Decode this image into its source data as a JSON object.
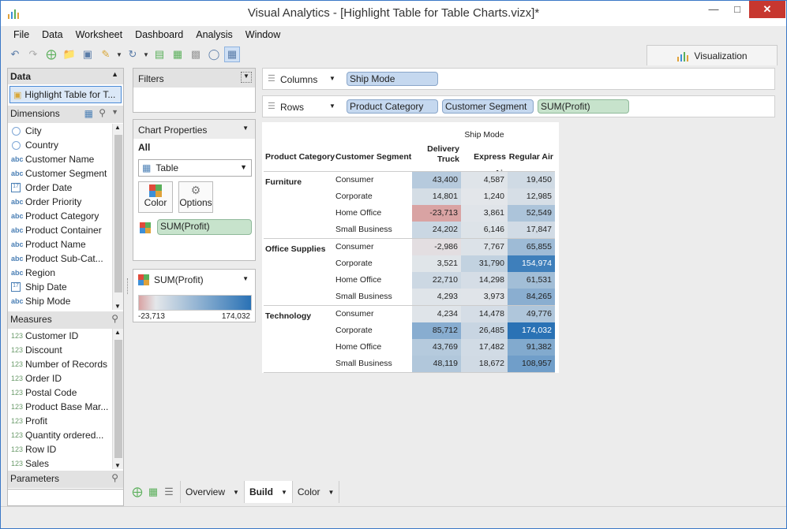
{
  "window": {
    "title": "Visual Analytics - [Highlight Table for Table Charts.vizx]*"
  },
  "menu": [
    "File",
    "Data",
    "Worksheet",
    "Dashboard",
    "Analysis",
    "Window"
  ],
  "viz_tab": "Visualization",
  "data_pane": {
    "header": "Data",
    "datasource": "Highlight Table for T...",
    "dimensions_label": "Dimensions",
    "dimensions": [
      {
        "label": "City",
        "type": "geo"
      },
      {
        "label": "Country",
        "type": "geo"
      },
      {
        "label": "Customer Name",
        "type": "abc"
      },
      {
        "label": "Customer Segment",
        "type": "abc"
      },
      {
        "label": "Order Date",
        "type": "date"
      },
      {
        "label": "Order Priority",
        "type": "abc"
      },
      {
        "label": "Product Category",
        "type": "abc"
      },
      {
        "label": "Product Container",
        "type": "abc"
      },
      {
        "label": "Product Name",
        "type": "abc"
      },
      {
        "label": "Product Sub-Cat...",
        "type": "abc"
      },
      {
        "label": "Region",
        "type": "abc"
      },
      {
        "label": "Ship Date",
        "type": "date"
      },
      {
        "label": "Ship Mode",
        "type": "abc"
      }
    ],
    "measures_label": "Measures",
    "measures": [
      "Customer ID",
      "Discount",
      "Number of Records",
      "Order ID",
      "Postal Code",
      "Product Base Mar...",
      "Profit",
      "Quantity ordered...",
      "Row ID",
      "Sales"
    ],
    "parameters_label": "Parameters",
    "type_labels": {
      "abc": "abc",
      "num": "123",
      "date": "17"
    }
  },
  "filters": {
    "label": "Filters"
  },
  "chart_props": {
    "label": "Chart Properties",
    "scope": "All",
    "chart_type": "Table",
    "color_btn": "Color",
    "options_btn": "Options",
    "measure_pill": "SUM(Profit)"
  },
  "legend": {
    "label": "SUM(Profit)",
    "min": "-23,713",
    "max": "174,032"
  },
  "shelves": {
    "columns_label": "Columns",
    "rows_label": "Rows",
    "columns": [
      "Ship Mode"
    ],
    "rows": [
      "Product Category",
      "Customer Segment"
    ],
    "rows_measure": "SUM(Profit)"
  },
  "table": {
    "col_header_title": "Ship Mode",
    "row_headers": [
      "Product Category",
      "Customer Segment"
    ],
    "col_headers": [
      "Delivery Truck",
      "Express Air",
      "Regular Air"
    ],
    "groups": [
      {
        "category": "Furniture",
        "rows": [
          {
            "segment": "Consumer",
            "values": [
              "43,400",
              "4,587",
              "19,450"
            ]
          },
          {
            "segment": "Corporate",
            "values": [
              "14,801",
              "1,240",
              "12,985"
            ]
          },
          {
            "segment": "Home Office",
            "values": [
              "-23,713",
              "3,861",
              "52,549"
            ]
          },
          {
            "segment": "Small Business",
            "values": [
              "24,202",
              "6,146",
              "17,847"
            ]
          }
        ]
      },
      {
        "category": "Office Supplies",
        "rows": [
          {
            "segment": "Consumer",
            "values": [
              "-2,986",
              "7,767",
              "65,855"
            ]
          },
          {
            "segment": "Corporate",
            "values": [
              "3,521",
              "31,790",
              "154,974"
            ]
          },
          {
            "segment": "Home Office",
            "values": [
              "22,710",
              "14,298",
              "61,531"
            ]
          },
          {
            "segment": "Small Business",
            "values": [
              "4,293",
              "3,973",
              "84,265"
            ]
          }
        ]
      },
      {
        "category": "Technology",
        "rows": [
          {
            "segment": "Consumer",
            "values": [
              "4,234",
              "14,478",
              "49,776"
            ]
          },
          {
            "segment": "Corporate",
            "values": [
              "85,712",
              "26,485",
              "174,032"
            ]
          },
          {
            "segment": "Home Office",
            "values": [
              "43,769",
              "17,482",
              "91,382"
            ]
          },
          {
            "segment": "Small Business",
            "values": [
              "48,119",
              "18,672",
              "108,957"
            ]
          }
        ]
      }
    ]
  },
  "sheet_tabs": [
    {
      "label": "Overview",
      "active": false
    },
    {
      "label": "Build",
      "active": true
    },
    {
      "label": "Color",
      "active": false
    }
  ],
  "colors": {
    "neg": "#d9a3a3",
    "pos": "#2a72b5",
    "mid": "#e4e7ea"
  }
}
